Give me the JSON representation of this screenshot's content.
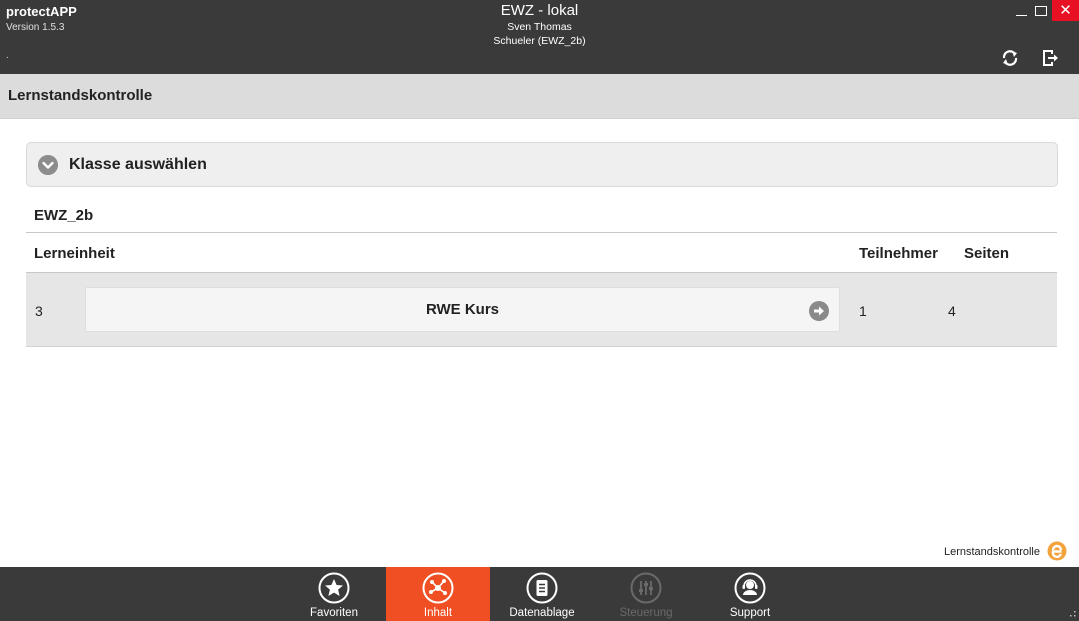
{
  "app": {
    "name": "protectAPP",
    "version": "Version 1.5.3",
    "dot": "."
  },
  "window": {
    "title": "EWZ - lokal",
    "user": "Sven Thomas",
    "role": "Schueler (EWZ_2b)",
    "close_glyph": "✕"
  },
  "page": {
    "title": "Lernstandskontrolle"
  },
  "class_select": {
    "label": "Klasse auswählen",
    "icon": "chevron-down-circle-icon"
  },
  "class_name": "EWZ_2b",
  "table": {
    "headers": {
      "unit": "Lerneinheit",
      "participants": "Teilnehmer",
      "pages": "Seiten"
    },
    "rows": [
      {
        "number": "3",
        "course": "RWE Kurs",
        "participants": "1",
        "pages": "4"
      }
    ]
  },
  "status": {
    "label": "Lernstandskontrolle",
    "logo_icon": "e-logo-icon"
  },
  "nav": {
    "items": [
      {
        "label": "Favoriten",
        "icon": "star-icon",
        "state": "normal"
      },
      {
        "label": "Inhalt",
        "icon": "network-icon",
        "state": "active"
      },
      {
        "label": "Datenablage",
        "icon": "document-icon",
        "state": "normal"
      },
      {
        "label": "Steuerung",
        "icon": "sliders-icon",
        "state": "disabled"
      },
      {
        "label": "Support",
        "icon": "headset-icon",
        "state": "normal"
      }
    ]
  },
  "colors": {
    "titlebar": "#3a3a3a",
    "accent": "#f04e23",
    "close": "#e81123",
    "header": "#dcdcdc",
    "row": "#e6e6e6"
  }
}
